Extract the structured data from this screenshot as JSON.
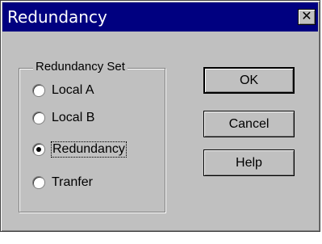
{
  "window": {
    "title": "Redundancy",
    "close_glyph": "✕"
  },
  "group": {
    "legend": "Redundancy Set",
    "options": [
      {
        "label": "Local A",
        "selected": false
      },
      {
        "label": "Local B",
        "selected": false
      },
      {
        "label": "Redundancy",
        "selected": true
      },
      {
        "label": "Tranfer",
        "selected": false
      }
    ]
  },
  "buttons": {
    "ok": "OK",
    "cancel": "Cancel",
    "help": "Help"
  },
  "colors": {
    "titlebar": "#000080",
    "face": "#c0c0c0"
  }
}
